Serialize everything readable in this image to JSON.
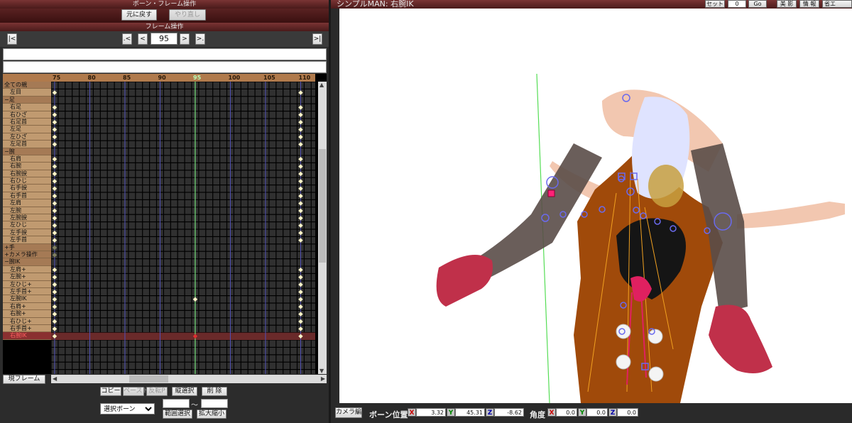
{
  "bone_panel": {
    "title": "ボーン・フレーム操作",
    "undo_label": "元に戻す",
    "redo_label": "やり直し"
  },
  "frame_panel": {
    "title": "フレーム操作",
    "first_label": "|<",
    "prev_key_label": ".<",
    "prev_label": "<",
    "frame_value": "95",
    "next_label": ">",
    "next_key_label": ">.",
    "last_label": ">|"
  },
  "ruler": {
    "labels": [
      "75",
      "80",
      "85",
      "90",
      "95",
      "100",
      "105",
      "110"
    ],
    "current": "95"
  },
  "bones": [
    {
      "label": "全ての親",
      "type": "group"
    },
    {
      "label": "左目",
      "type": "item"
    },
    {
      "label": "−足",
      "type": "group"
    },
    {
      "label": "右足",
      "type": "item"
    },
    {
      "label": "右ひざ",
      "type": "item"
    },
    {
      "label": "右足首",
      "type": "item"
    },
    {
      "label": "左足",
      "type": "item"
    },
    {
      "label": "左ひざ",
      "type": "item"
    },
    {
      "label": "左足首",
      "type": "item"
    },
    {
      "label": "−腕",
      "type": "group"
    },
    {
      "label": "右肩",
      "type": "item"
    },
    {
      "label": "右腕",
      "type": "item"
    },
    {
      "label": "右腕捩",
      "type": "item"
    },
    {
      "label": "右ひじ",
      "type": "item"
    },
    {
      "label": "右手捩",
      "type": "item"
    },
    {
      "label": "右手首",
      "type": "item"
    },
    {
      "label": "左肩",
      "type": "item"
    },
    {
      "label": "左腕",
      "type": "item"
    },
    {
      "label": "左腕捩",
      "type": "item"
    },
    {
      "label": "左ひじ",
      "type": "item"
    },
    {
      "label": "左手捩",
      "type": "item"
    },
    {
      "label": "左手首",
      "type": "item"
    },
    {
      "label": "+手",
      "type": "group"
    },
    {
      "label": "+カメラ操作",
      "type": "group"
    },
    {
      "label": "−腕IK",
      "type": "group"
    },
    {
      "label": "左肩+",
      "type": "item"
    },
    {
      "label": "左腕+",
      "type": "item"
    },
    {
      "label": "左ひじ+",
      "type": "item"
    },
    {
      "label": "左手首+",
      "type": "item"
    },
    {
      "label": "左腕IK",
      "type": "item"
    },
    {
      "label": "右肩+",
      "type": "item"
    },
    {
      "label": "右腕+",
      "type": "item"
    },
    {
      "label": "右ひじ+",
      "type": "item"
    },
    {
      "label": "右手首+",
      "type": "item"
    },
    {
      "label": "右腕IK",
      "type": "selected"
    }
  ],
  "bottom_controls": {
    "current_frame_label": "現フレーム",
    "copy_label": "コピー",
    "paste_label": "ペースト",
    "reverse_paste_label": "反転P",
    "vertical_select_label": "縦選択",
    "delete_label": "削 除",
    "select_bone_value": "選択ボーン",
    "tilde": "〜",
    "range_select_label": "範囲選択",
    "zoom_label": "拡大縮小"
  },
  "viewport": {
    "title": "シンプルMAN: 右腕IK",
    "set_label": "セット",
    "set_value": "0",
    "go_label": "Go",
    "beauty_label": "美 影",
    "info_label": "情 報",
    "omit_label": "省エ"
  },
  "status_bar": {
    "camera_label": "カメラ編",
    "bone_pos_label": "ボーン位置",
    "pos_x": "3.32",
    "pos_y": "45.31",
    "pos_z": "-8.62",
    "angle_label": "角度",
    "ang_x": "0.0",
    "ang_y": "0.0",
    "ang_z": "0.0",
    "x_axis": "X",
    "y_axis": "Y",
    "z_axis": "Z"
  },
  "colors": {
    "titlebar": "#5a2222",
    "ruler": "#b07a4c",
    "keyframe": "#fff6c8",
    "selected_key": "#e03030",
    "current_frame_line": "#7dff7d",
    "model_skin": "#f2c7b0",
    "model_body": "#a04a0a",
    "stocking": "#5a4c48",
    "boot": "#c0304a",
    "bone_marker": "#6a6aee"
  }
}
